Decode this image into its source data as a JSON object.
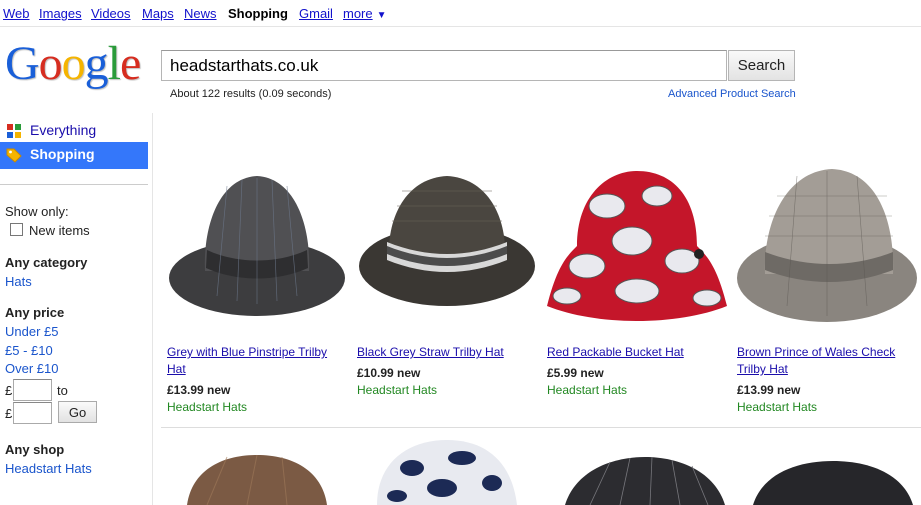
{
  "nav": {
    "web": "Web",
    "images": "Images",
    "videos": "Videos",
    "maps": "Maps",
    "news": "News",
    "shopping": "Shopping",
    "gmail": "Gmail",
    "more": "more"
  },
  "logo": {
    "letters": [
      "G",
      "o",
      "o",
      "g",
      "l",
      "e"
    ],
    "colors": [
      "#1a5fd8",
      "#d62d20",
      "#f5b400",
      "#1a5fd8",
      "#2a9b3a",
      "#d62d20"
    ]
  },
  "search": {
    "query": "headstarthats.co.uk",
    "button_label": "Search"
  },
  "result_stats": "About 122 results (0.09 seconds)",
  "advanced_link": "Advanced Product Search",
  "sidebar": {
    "modes": [
      {
        "label": "Everything",
        "icon": "everything-icon"
      },
      {
        "label": "Shopping",
        "icon": "shopping-tag-icon",
        "selected": true
      }
    ],
    "show_only": "Show only:",
    "new_items": "New items",
    "category_heading": "Any category",
    "category_link": "Hats",
    "price_heading": "Any price",
    "price_links": [
      "Under £5",
      "£5 - £10",
      "Over £10"
    ],
    "currency": "£",
    "to": "to",
    "go_label": "Go",
    "shop_heading": "Any shop",
    "shop_link": "Headstart Hats"
  },
  "products": [
    {
      "title": "Grey with Blue Pinstripe Trilby Hat",
      "price": "£13.99 new",
      "shop": "Headstart Hats"
    },
    {
      "title": "Black Grey Straw Trilby Hat",
      "price": "£10.99 new",
      "shop": "Headstart Hats"
    },
    {
      "title": "Red Packable Bucket Hat",
      "price": "£5.99 new",
      "shop": "Headstart Hats"
    },
    {
      "title": "Brown Prince of Wales Check Trilby Hat",
      "price": "£13.99 new",
      "shop": "Headstart Hats"
    }
  ],
  "colors": {
    "link": "#1a0dab",
    "shop_green": "#228822",
    "selected_mode": "#3477fa"
  }
}
